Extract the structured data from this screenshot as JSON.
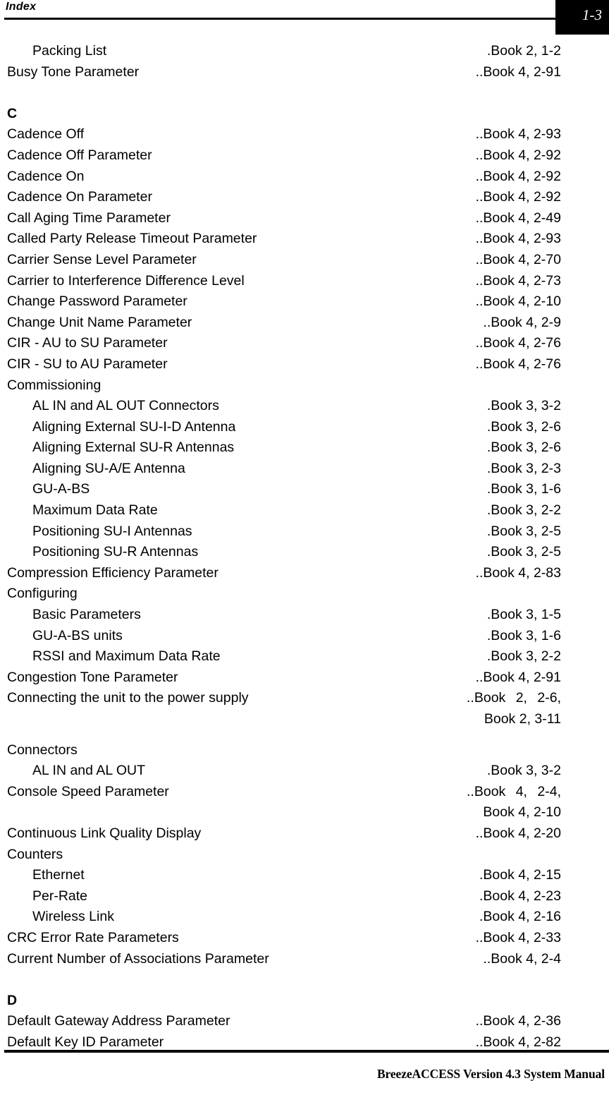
{
  "header": {
    "running_head": "Index",
    "page_number": "1-3"
  },
  "footer": {
    "manual_title": "BreezeACCESS Version 4.3 System Manual"
  },
  "index": {
    "rows": [
      {
        "kind": "entry",
        "level": 1,
        "label": "Packing List",
        "ref": " .Book 2, 1-2"
      },
      {
        "kind": "entry",
        "level": 0,
        "label": "Busy Tone Parameter",
        "ref": "..Book 4, 2-91"
      },
      {
        "kind": "gap"
      },
      {
        "kind": "letter",
        "letter": "C"
      },
      {
        "kind": "entry",
        "level": 0,
        "label": "Cadence Off",
        "ref": "..Book 4, 2-93"
      },
      {
        "kind": "entry",
        "level": 0,
        "label": "Cadence Off Parameter",
        "ref": "..Book 4, 2-92"
      },
      {
        "kind": "entry",
        "level": 0,
        "label": "Cadence On",
        "ref": "..Book 4, 2-92"
      },
      {
        "kind": "entry",
        "level": 0,
        "label": "Cadence On Parameter",
        "ref": "..Book 4, 2-92"
      },
      {
        "kind": "entry",
        "level": 0,
        "label": "Call Aging Time Parameter",
        "ref": "..Book 4, 2-49"
      },
      {
        "kind": "entry",
        "level": 0,
        "label": "Called Party Release Timeout Parameter",
        "ref": "..Book 4, 2-93"
      },
      {
        "kind": "entry",
        "level": 0,
        "label": "Carrier Sense Level Parameter",
        "ref": "..Book 4, 2-70"
      },
      {
        "kind": "entry",
        "level": 0,
        "label": "Carrier to Interference Difference Level",
        "ref": "..Book 4, 2-73"
      },
      {
        "kind": "entry",
        "level": 0,
        "label": "Change Password Parameter",
        "ref": "..Book 4, 2-10"
      },
      {
        "kind": "entry",
        "level": 0,
        "label": "Change Unit Name Parameter",
        "ref": "..Book 4, 2-9"
      },
      {
        "kind": "entry",
        "level": 0,
        "label": "CIR - AU to SU Parameter",
        "ref": "..Book 4, 2-76"
      },
      {
        "kind": "entry",
        "level": 0,
        "label": "CIR - SU to AU Parameter",
        "ref": "..Book 4, 2-76"
      },
      {
        "kind": "entry",
        "level": 0,
        "label": "Commissioning",
        "ref": ""
      },
      {
        "kind": "entry",
        "level": 1,
        "label": "AL IN and AL OUT Connectors",
        "ref": ".Book 3, 3-2"
      },
      {
        "kind": "entry",
        "level": 1,
        "label": "Aligning External SU-I-D Antenna",
        "ref": ".Book 3, 2-6"
      },
      {
        "kind": "entry",
        "level": 1,
        "label": "Aligning External SU-R Antennas",
        "ref": ".Book 3, 2-6"
      },
      {
        "kind": "entry",
        "level": 1,
        "label": "Aligning SU-A/E Antenna",
        "ref": ".Book 3, 2-3"
      },
      {
        "kind": "entry",
        "level": 1,
        "label": "GU-A-BS",
        "ref": ".Book 3, 1-6"
      },
      {
        "kind": "entry",
        "level": 1,
        "label": "Maximum Data Rate",
        "ref": ".Book 3, 2-2"
      },
      {
        "kind": "entry",
        "level": 1,
        "label": "Positioning SU-I Antennas",
        "ref": ".Book 3, 2-5"
      },
      {
        "kind": "entry",
        "level": 1,
        "label": "Positioning SU-R Antennas",
        "ref": ".Book 3, 2-5"
      },
      {
        "kind": "entry",
        "level": 0,
        "label": "Compression Efficiency Parameter",
        "ref": "..Book 4, 2-83"
      },
      {
        "kind": "entry",
        "level": 0,
        "label": "Configuring",
        "ref": ""
      },
      {
        "kind": "entry",
        "level": 1,
        "label": "Basic Parameters",
        "ref": ".Book 3, 1-5"
      },
      {
        "kind": "entry",
        "level": 1,
        "label": "GU-A-BS units",
        "ref": ".Book 3, 1-6"
      },
      {
        "kind": "entry",
        "level": 1,
        "label": "RSSI and Maximum Data Rate",
        "ref": ".Book 3, 2-2"
      },
      {
        "kind": "entry",
        "level": 0,
        "label": "Congestion Tone Parameter",
        "ref": "..Book 4, 2-91"
      },
      {
        "kind": "entry",
        "level": 0,
        "label": "Connecting the unit to the power supply",
        "ref": "..Book 2, 2-6,",
        "ref_spaced": true
      },
      {
        "kind": "cont",
        "ref": "Book 2, 3-11"
      },
      {
        "kind": "gap-small"
      },
      {
        "kind": "entry",
        "level": 0,
        "label": "Connectors",
        "ref": ""
      },
      {
        "kind": "entry",
        "level": 1,
        "label": "AL IN and AL OUT",
        "ref": ".Book 3, 3-2"
      },
      {
        "kind": "entry",
        "level": 0,
        "label": "Console Speed Parameter",
        "ref": "..Book 4, 2-4,",
        "ref_spaced": true
      },
      {
        "kind": "cont",
        "ref": "Book 4, 2-10"
      },
      {
        "kind": "entry",
        "level": 0,
        "label": "Continuous Link Quality Display",
        "ref": "..Book 4, 2-20"
      },
      {
        "kind": "entry",
        "level": 0,
        "label": "Counters",
        "ref": ""
      },
      {
        "kind": "entry",
        "level": 1,
        "label": "Ethernet",
        "ref": ".Book 4, 2-15"
      },
      {
        "kind": "entry",
        "level": 1,
        "label": "Per-Rate",
        "ref": ".Book 4, 2-23"
      },
      {
        "kind": "entry",
        "level": 1,
        "label": "Wireless Link",
        "ref": ".Book 4, 2-16"
      },
      {
        "kind": "entry",
        "level": 0,
        "label": "CRC Error Rate Parameters",
        "ref": "..Book 4, 2-33"
      },
      {
        "kind": "entry",
        "level": 0,
        "label": "Current Number of Associations Parameter",
        "ref": "..Book 4, 2-4"
      },
      {
        "kind": "gap"
      },
      {
        "kind": "letter",
        "letter": "D"
      },
      {
        "kind": "entry",
        "level": 0,
        "label": "Default Gateway Address Parameter",
        "ref": "..Book 4, 2-36"
      },
      {
        "kind": "entry",
        "level": 0,
        "label": "Default Key ID Parameter",
        "ref": "..Book 4, 2-82"
      }
    ]
  }
}
